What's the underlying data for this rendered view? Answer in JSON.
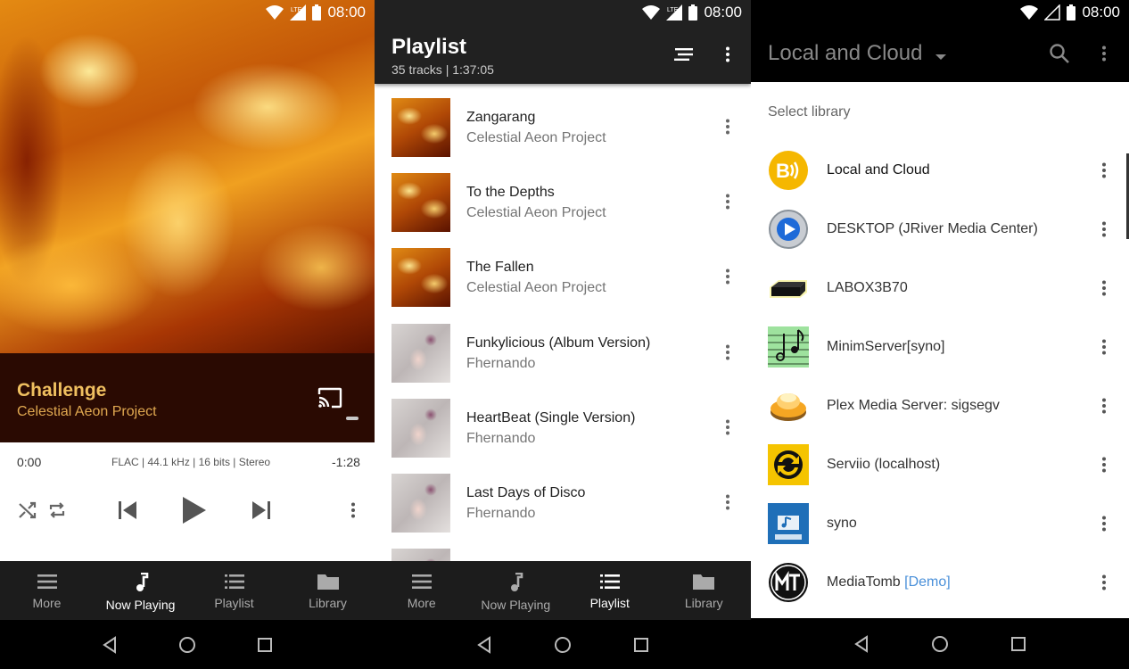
{
  "status_bar": {
    "time": "08:00",
    "network": "LTE"
  },
  "now_playing": {
    "title": "Challenge",
    "artist": "Celestial Aeon Project",
    "position": "0:00",
    "format": "FLAC | 44.1 kHz | 16 bits | Stereo",
    "remaining": "-1:28"
  },
  "playlist": {
    "title": "Playlist",
    "subtitle": "35 tracks | 1:37:05",
    "tracks": [
      {
        "name": "Zangarang",
        "artist": "Celestial Aeon Project",
        "art": "fire"
      },
      {
        "name": "To the Depths",
        "artist": "Celestial Aeon Project",
        "art": "fire"
      },
      {
        "name": "The Fallen",
        "artist": "Celestial Aeon Project",
        "art": "fire"
      },
      {
        "name": "Funkylicious (Album Version)",
        "artist": "Fhernando",
        "art": "doll"
      },
      {
        "name": "HeartBeat (Single Version)",
        "artist": "Fhernando",
        "art": "doll"
      },
      {
        "name": "Last Days of Disco",
        "artist": "Fhernando",
        "art": "doll"
      }
    ]
  },
  "bottom_nav": {
    "items": [
      {
        "label": "More",
        "icon": "menu-icon"
      },
      {
        "label": "Now Playing",
        "icon": "music-note-icon"
      },
      {
        "label": "Playlist",
        "icon": "list-icon"
      },
      {
        "label": "Library",
        "icon": "folder-icon"
      }
    ],
    "active_screen1": "Now Playing",
    "active_screen2": "Playlist"
  },
  "library": {
    "title": "Local and Cloud",
    "header": "Select library",
    "items": [
      {
        "name": "Local and Cloud",
        "icon": "bubbleupnp-icon"
      },
      {
        "name": "DESKTOP (JRiver Media Center)",
        "icon": "jriver-icon"
      },
      {
        "name": "LABOX3B70",
        "icon": "settop-box-icon"
      },
      {
        "name": "MinimServer[syno]",
        "icon": "minimserver-icon"
      },
      {
        "name": "Plex Media Server: sigsegv",
        "icon": "plex-icon"
      },
      {
        "name": "Serviio (localhost)",
        "icon": "serviio-icon"
      },
      {
        "name": "syno",
        "icon": "synology-icon"
      },
      {
        "name": "MediaTomb",
        "demo": "[Demo]",
        "icon": "mediatomb-icon"
      }
    ]
  },
  "colors": {
    "accent_gold": "#f0c060",
    "appbar_dark": "#212121",
    "nav_dark": "#1c1c1c",
    "demo_link": "#4a90d9"
  }
}
